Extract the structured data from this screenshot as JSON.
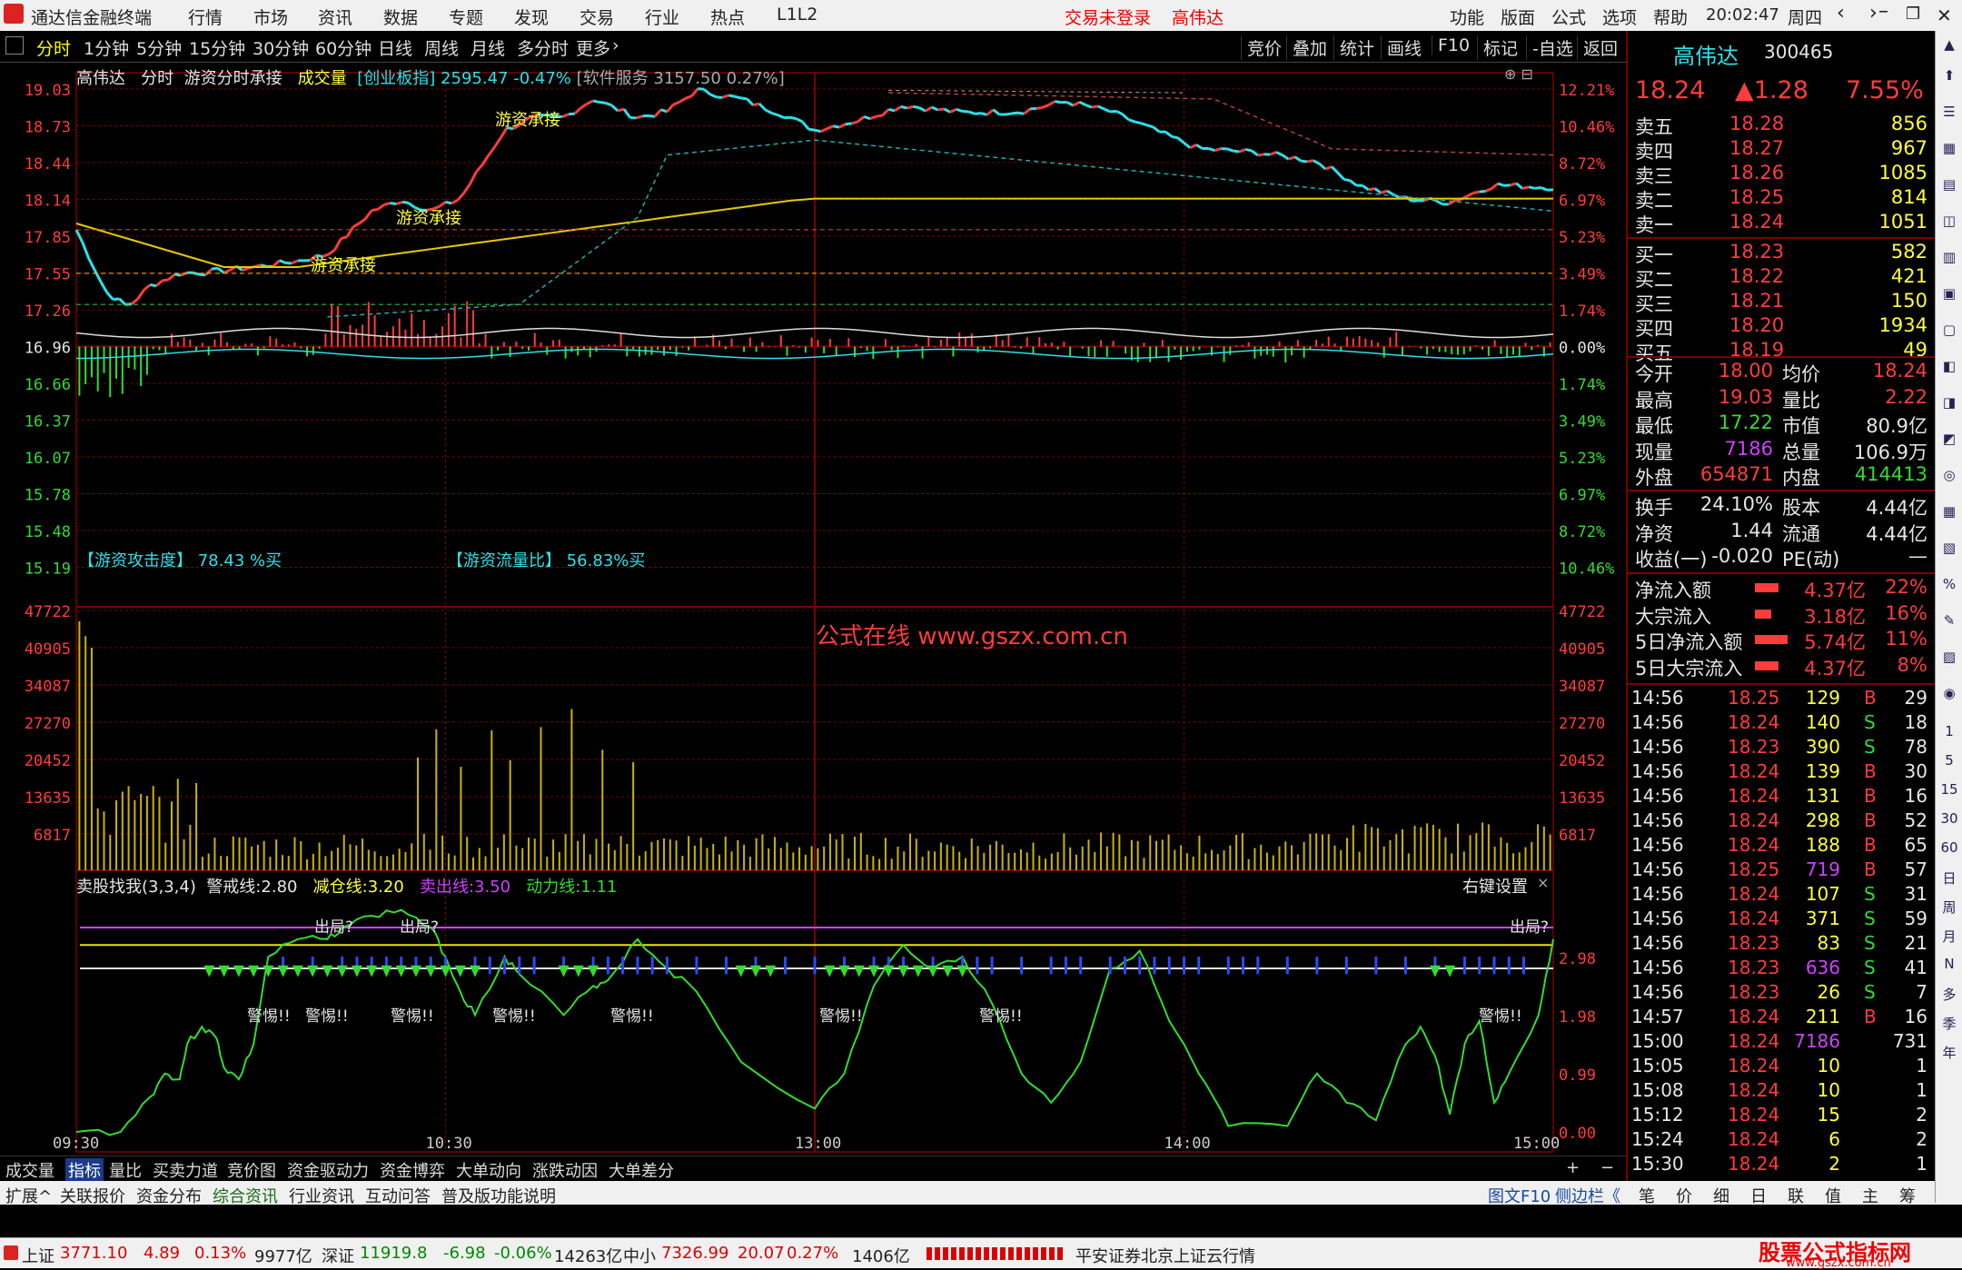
{
  "menubar": {
    "app_title": "通达信金融终端",
    "items": [
      "行情",
      "市场",
      "资讯",
      "数据",
      "专题",
      "发现",
      "交易",
      "行业",
      "热点",
      "L1L2"
    ],
    "trade_status": "交易未登录",
    "stock_name": "高伟达",
    "right_items": [
      "功能",
      "版面",
      "公式",
      "选项",
      "帮助"
    ],
    "time": "20:02:47",
    "weekday": "周四"
  },
  "timeframes": [
    "分时",
    "1分钟",
    "5分钟",
    "15分钟",
    "30分钟",
    "60分钟",
    "日线",
    "周线",
    "月线",
    "多分时",
    "更多"
  ],
  "chart_tools": [
    "竞价",
    "叠加",
    "统计",
    "画线",
    "F10",
    "标记",
    "-自选",
    "返回"
  ],
  "main_title": {
    "stock": "高伟达",
    "mode": "分时",
    "formula": "游资分时承接",
    "vol_label": "成交量",
    "index_label": "创业板指",
    "index_value": "2595.47",
    "index_change": "-0.47%",
    "service_label": "软件服务",
    "service_value": "3157.50",
    "service_change": "0.27%"
  },
  "price_axis_left": [
    "19.03",
    "18.73",
    "18.44",
    "18.14",
    "17.85",
    "17.55",
    "17.26",
    "16.96",
    "16.66",
    "16.37",
    "16.07",
    "15.78",
    "15.48",
    "15.19"
  ],
  "pct_axis_right": [
    "12.21%",
    "10.46%",
    "8.72%",
    "6.97%",
    "5.23%",
    "3.49%",
    "1.74%",
    "0.00%",
    "1.74%",
    "3.49%",
    "5.23%",
    "6.97%",
    "8.72%",
    "10.46%"
  ],
  "annotations": {
    "chengjie": "游资承接",
    "attack_label": "【游资攻击度】",
    "attack_value": "78.43 %买",
    "flow_label": "【游资流量比】",
    "flow_value": "56.83%买",
    "watermark": "公式在线  www.gszx.com.cn"
  },
  "vol_axis": [
    "47722",
    "40905",
    "34087",
    "27270",
    "20452",
    "13635",
    "6817"
  ],
  "indicator": {
    "name": "卖股找我(3,3,4)",
    "lines": [
      {
        "label": "警戒线:",
        "value": "2.80"
      },
      {
        "label": "减仓线:",
        "value": "3.20"
      },
      {
        "label": "卖出线:",
        "value": "3.50"
      },
      {
        "label": "动力线:",
        "value": "1.11"
      }
    ],
    "right_setting": "右键设置",
    "axis": [
      "2.98",
      "1.98",
      "0.99",
      "0.00"
    ],
    "signal_out": "出局?",
    "signal_warn": "警惕!!"
  },
  "time_axis": [
    "09:30",
    "10:30",
    "13:00",
    "14:00",
    "15:00"
  ],
  "bottom_tabs": [
    "成交量",
    "指标",
    "量比",
    "买卖力道",
    "竞价图",
    "资金驱动力",
    "资金博弈",
    "大单动向",
    "涨跌动因",
    "大单差分"
  ],
  "bottom_tabs2": [
    "扩展^",
    "关联报价",
    "资金分布",
    "综合资讯",
    "行业资讯",
    "互动问答",
    "普及版功能说明"
  ],
  "bottom_right_links": [
    "图文F10",
    "侧边栏《"
  ],
  "quote": {
    "name": "高伟达",
    "code": "300465",
    "price": "18.24",
    "change": "▲1.28",
    "pct": "7.55%",
    "asks": [
      {
        "label": "卖五",
        "price": "18.28",
        "vol": "856"
      },
      {
        "label": "卖四",
        "price": "18.27",
        "vol": "967"
      },
      {
        "label": "卖三",
        "price": "18.26",
        "vol": "1085"
      },
      {
        "label": "卖二",
        "price": "18.25",
        "vol": "814"
      },
      {
        "label": "卖一",
        "price": "18.24",
        "vol": "1051"
      }
    ],
    "bids": [
      {
        "label": "买一",
        "price": "18.23",
        "vol": "582"
      },
      {
        "label": "买二",
        "price": "18.22",
        "vol": "421"
      },
      {
        "label": "买三",
        "price": "18.21",
        "vol": "150"
      },
      {
        "label": "买四",
        "price": "18.20",
        "vol": "1934"
      },
      {
        "label": "买五",
        "price": "18.19",
        "vol": "49"
      }
    ],
    "stats": [
      [
        "今开",
        "18.00",
        "均价",
        "18.24"
      ],
      [
        "最高",
        "19.03",
        "量比",
        "2.22"
      ],
      [
        "最低",
        "17.22",
        "市值",
        "80.9亿"
      ],
      [
        "现量",
        "7186",
        "总量",
        "106.9万"
      ],
      [
        "外盘",
        "654871",
        "内盘",
        "414413"
      ],
      [
        "换手",
        "24.10%",
        "股本",
        "4.44亿"
      ],
      [
        "净资",
        "1.44",
        "流通",
        "4.44亿"
      ],
      [
        "收益(一)",
        "-0.020",
        "PE(动)",
        "—"
      ]
    ],
    "flows": [
      [
        "净流入额",
        "4.37亿",
        "22%"
      ],
      [
        "大宗流入",
        "3.18亿",
        "16%"
      ],
      [
        "5日净流入额",
        "5.74亿",
        "11%"
      ],
      [
        "5日大宗流入",
        "4.37亿",
        "8%"
      ]
    ],
    "ticks": [
      [
        "14:56",
        "18.25",
        "129",
        "B",
        "29"
      ],
      [
        "14:56",
        "18.24",
        "140",
        "S",
        "18"
      ],
      [
        "14:56",
        "18.23",
        "390",
        "S",
        "78"
      ],
      [
        "14:56",
        "18.24",
        "139",
        "B",
        "30"
      ],
      [
        "14:56",
        "18.24",
        "131",
        "B",
        "16"
      ],
      [
        "14:56",
        "18.24",
        "298",
        "B",
        "52"
      ],
      [
        "14:56",
        "18.24",
        "188",
        "B",
        "65"
      ],
      [
        "14:56",
        "18.25",
        "719",
        "B",
        "57"
      ],
      [
        "14:56",
        "18.24",
        "107",
        "S",
        "31"
      ],
      [
        "14:56",
        "18.24",
        "371",
        "S",
        "59"
      ],
      [
        "14:56",
        "18.23",
        "83",
        "S",
        "21"
      ],
      [
        "14:56",
        "18.23",
        "636",
        "S",
        "41"
      ],
      [
        "14:56",
        "18.23",
        "26",
        "S",
        "7"
      ],
      [
        "14:57",
        "18.24",
        "211",
        "B",
        "16"
      ],
      [
        "15:00",
        "18.24",
        "7186",
        "",
        "731"
      ],
      [
        "15:05",
        "18.24",
        "10",
        "",
        "1"
      ],
      [
        "15:08",
        "18.24",
        "10",
        "",
        "1"
      ],
      [
        "15:12",
        "18.24",
        "15",
        "",
        "2"
      ],
      [
        "15:24",
        "18.24",
        "6",
        "",
        "2"
      ],
      [
        "15:30",
        "18.24",
        "2",
        "",
        "1"
      ]
    ],
    "tabs": [
      "笔",
      "价",
      "细",
      "日",
      "联",
      "值",
      "主",
      "筹"
    ]
  },
  "sidebar": [
    "1",
    "5",
    "15",
    "30",
    "60",
    "日",
    "周",
    "月",
    "N",
    "多",
    "季",
    "年"
  ],
  "status": {
    "sh_label": "上证",
    "sh_value": "3771.10",
    "sh_chg": "4.89",
    "sh_pct": "0.13%",
    "sh_amt": "9977亿",
    "sz_label": "深证",
    "sz_value": "11919.8",
    "sz_chg": "-6.98",
    "sz_pct": "-0.06%",
    "sz_amt": "14263亿",
    "zx_label": "中小",
    "zx_value": "7326.99",
    "zx_chg": "20.07",
    "zx_pct": "0.27%",
    "zx_amt": "1406亿",
    "broker": "平安证券北京上证云行情",
    "brand": "股票公式指标网",
    "brand_url": "www.gszx.com.cn"
  },
  "colors": {
    "up": "#ff3c3c",
    "down": "#32dc32",
    "price_line": "#2ee0e8",
    "avg_line": "#e6c800",
    "grid": "#7a0000",
    "bg": "#000000"
  }
}
